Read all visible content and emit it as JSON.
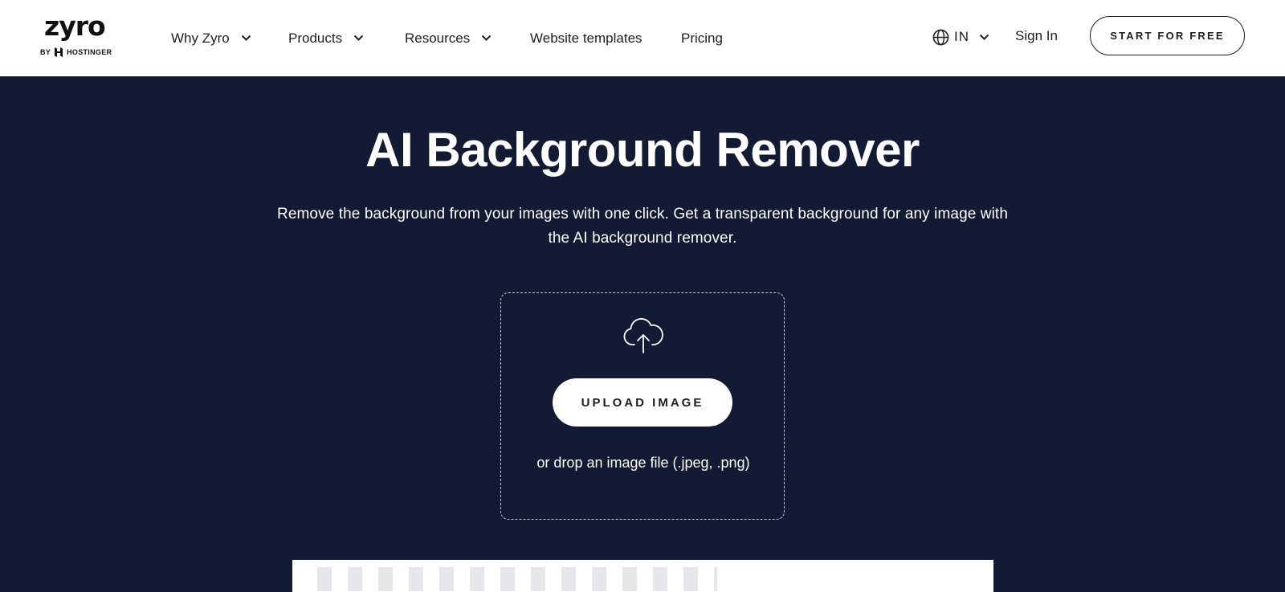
{
  "header": {
    "logo": {
      "word": "zyro",
      "byline": "BY",
      "brand": "HOSTINGER"
    },
    "nav": [
      {
        "label": "Why Zyro",
        "has_dropdown": true
      },
      {
        "label": "Products",
        "has_dropdown": true
      },
      {
        "label": "Resources",
        "has_dropdown": true
      },
      {
        "label": "Website templates",
        "has_dropdown": false
      },
      {
        "label": "Pricing",
        "has_dropdown": false
      }
    ],
    "language": {
      "icon": "globe-icon",
      "label": "IN"
    },
    "signin_label": "Sign In",
    "cta_label": "START FOR FREE"
  },
  "hero": {
    "title": "AI Background Remover",
    "subtitle": "Remove the background from your images with one click. Get a transparent background for any image with the AI background remover."
  },
  "upload": {
    "icon": "cloud-upload-icon",
    "button_label": "UPLOAD IMAGE",
    "hint": "or drop an image file (.jpeg, .png)"
  },
  "colors": {
    "hero_bg": "#121b33",
    "header_bg": "#ffffff",
    "text_dark": "#1d1e20",
    "text_light": "#ffffff"
  }
}
